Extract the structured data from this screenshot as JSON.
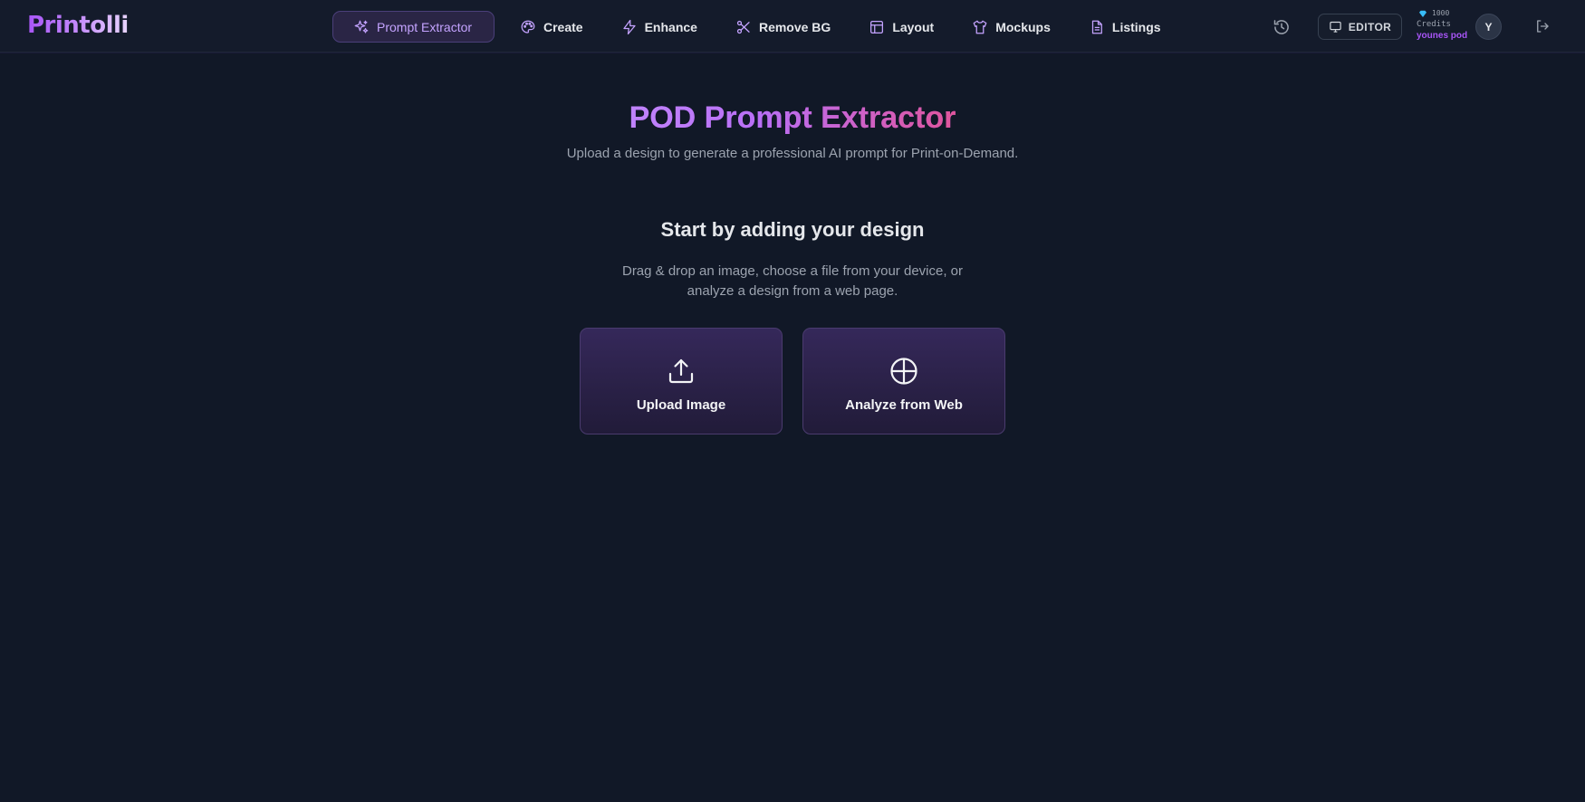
{
  "app": {
    "logo_text": "Printolli"
  },
  "nav": {
    "items": [
      {
        "label": "Prompt Extractor",
        "icon": "sparkles-icon",
        "active": true
      },
      {
        "label": "Create",
        "icon": "palette-icon"
      },
      {
        "label": "Enhance",
        "icon": "lightning-icon"
      },
      {
        "label": "Remove BG",
        "icon": "scissors-icon"
      },
      {
        "label": "Layout",
        "icon": "layout-icon"
      },
      {
        "label": "Mockups",
        "icon": "tshirt-icon"
      },
      {
        "label": "Listings",
        "icon": "document-icon"
      }
    ]
  },
  "header_right": {
    "history_icon": "history-icon",
    "editor_label": "EDITOR",
    "credits_amount": "1000",
    "credits_label": "Credits",
    "username": "younes pod",
    "avatar_initial": "Y",
    "logout_icon": "logout-icon"
  },
  "main": {
    "title": "POD Prompt Extractor",
    "subtitle": "Upload a design to generate a professional AI prompt for Print-on-Demand.",
    "section_title": "Start by adding your design",
    "section_desc_line1": "Drag & drop an image, choose a file from your device, or",
    "section_desc_line2": "analyze a design from a web page.",
    "cards": [
      {
        "label": "Upload Image",
        "icon": "upload-icon"
      },
      {
        "label": "Analyze from Web",
        "icon": "globe-icon"
      }
    ]
  },
  "colors": {
    "background": "#111827",
    "topbar": "#141b2b",
    "accent": "#a855f7",
    "accent_pink": "#ec4899",
    "card_bg": "#2a2147"
  }
}
